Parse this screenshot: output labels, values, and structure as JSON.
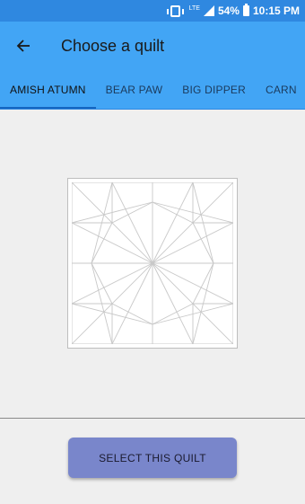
{
  "status_bar": {
    "network": "LTE",
    "battery": "54%",
    "time": "10:15 PM",
    "icons": [
      "vibrate-icon",
      "signal-icon",
      "battery-icon"
    ]
  },
  "app_bar": {
    "back_icon": "arrow-left-icon",
    "title": "Choose a quilt"
  },
  "tabs": [
    {
      "label": "AMISH ATUMN",
      "active": true
    },
    {
      "label": "BEAR PAW",
      "active": false
    },
    {
      "label": "BIG DIPPER",
      "active": false
    },
    {
      "label": "CARN",
      "active": false
    }
  ],
  "preview": {
    "pattern": "eight-point-star-quilt-block"
  },
  "actions": {
    "select_label": "SELECT THIS QUILT"
  },
  "colors": {
    "status_bar": "#2f88e0",
    "app_bar": "#42a5f5",
    "tab_indicator": "#1565c0",
    "button": "#7986cb",
    "background": "#efefef"
  }
}
